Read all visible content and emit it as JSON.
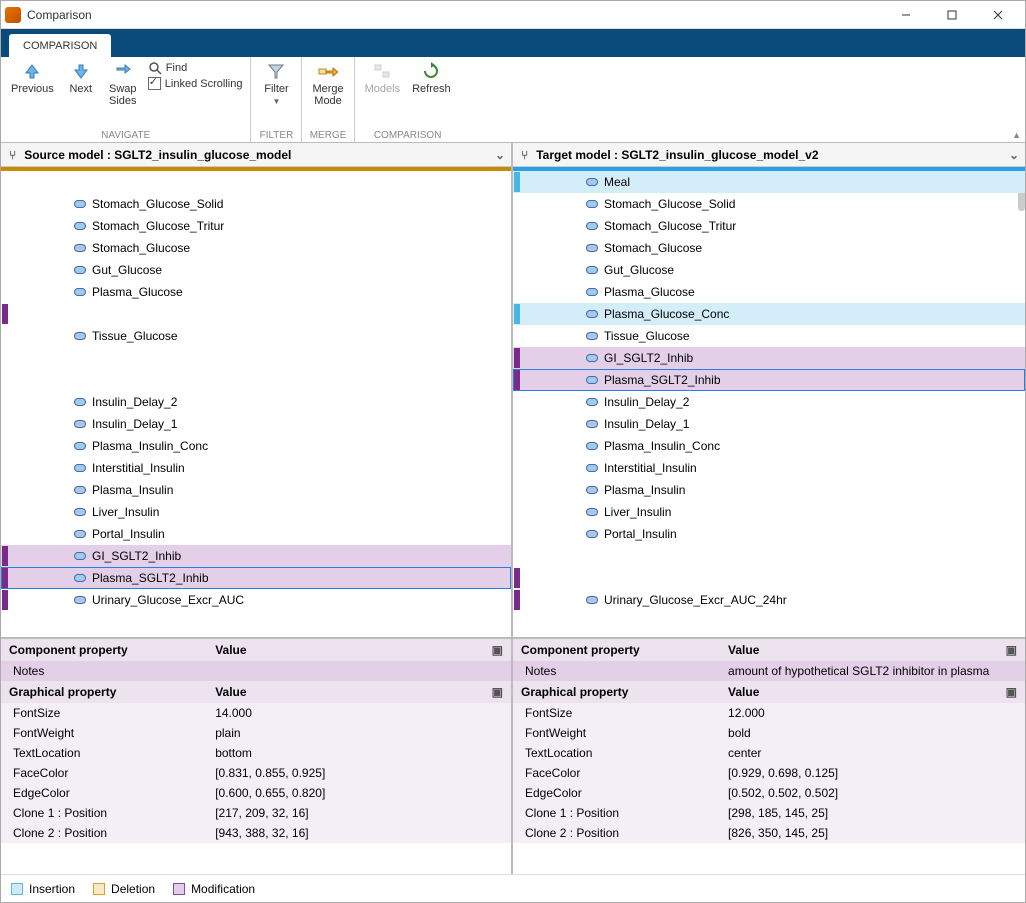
{
  "window": {
    "title": "Comparison"
  },
  "ribbon": {
    "tab": "COMPARISON"
  },
  "toolbar": {
    "previous": "Previous",
    "next": "Next",
    "swap": "Swap\nSides",
    "find": "Find",
    "linked_scrolling": "Linked Scrolling",
    "filter": "Filter",
    "merge": "Merge\nMode",
    "models": "Models",
    "refresh": "Refresh",
    "group_navigate": "NAVIGATE",
    "group_filter": "FILTER",
    "group_merge": "MERGE",
    "group_comparison": "COMPARISON"
  },
  "panes": {
    "source_label": "Source model : SGLT2_insulin_glucose_model",
    "target_label": "Target model : SGLT2_insulin_glucose_model_v2"
  },
  "source_rows": [
    {
      "label": "",
      "cls": "blank",
      "flag": ""
    },
    {
      "label": "Stomach_Glucose_Solid",
      "cls": "",
      "flag": ""
    },
    {
      "label": "Stomach_Glucose_Tritur",
      "cls": "",
      "flag": ""
    },
    {
      "label": "Stomach_Glucose",
      "cls": "",
      "flag": ""
    },
    {
      "label": "Gut_Glucose",
      "cls": "",
      "flag": ""
    },
    {
      "label": "Plasma_Glucose",
      "cls": "",
      "flag": ""
    },
    {
      "label": "",
      "cls": "blank",
      "flag": "modification"
    },
    {
      "label": "Tissue_Glucose",
      "cls": "",
      "flag": ""
    },
    {
      "label": "",
      "cls": "blank",
      "flag": ""
    },
    {
      "label": "",
      "cls": "blank",
      "flag": ""
    },
    {
      "label": "Insulin_Delay_2",
      "cls": "",
      "flag": ""
    },
    {
      "label": "Insulin_Delay_1",
      "cls": "",
      "flag": ""
    },
    {
      "label": "Plasma_Insulin_Conc",
      "cls": "",
      "flag": ""
    },
    {
      "label": "Interstitial_Insulin",
      "cls": "",
      "flag": ""
    },
    {
      "label": "Plasma_Insulin",
      "cls": "",
      "flag": ""
    },
    {
      "label": "Liver_Insulin",
      "cls": "",
      "flag": ""
    },
    {
      "label": "Portal_Insulin",
      "cls": "",
      "flag": ""
    },
    {
      "label": "GI_SGLT2_Inhib",
      "cls": "modification",
      "flag": "modification"
    },
    {
      "label": "Plasma_SGLT2_Inhib",
      "cls": "selected",
      "flag": "modification"
    },
    {
      "label": "Urinary_Glucose_Excr_AUC",
      "cls": "",
      "flag": "modification"
    }
  ],
  "target_rows": [
    {
      "label": "Meal",
      "cls": "insertion",
      "flag": "insertion"
    },
    {
      "label": "Stomach_Glucose_Solid",
      "cls": "",
      "flag": ""
    },
    {
      "label": "Stomach_Glucose_Tritur",
      "cls": "",
      "flag": ""
    },
    {
      "label": "Stomach_Glucose",
      "cls": "",
      "flag": ""
    },
    {
      "label": "Gut_Glucose",
      "cls": "",
      "flag": ""
    },
    {
      "label": "Plasma_Glucose",
      "cls": "",
      "flag": ""
    },
    {
      "label": "Plasma_Glucose_Conc",
      "cls": "insertion",
      "flag": "insertion"
    },
    {
      "label": "Tissue_Glucose",
      "cls": "",
      "flag": ""
    },
    {
      "label": "GI_SGLT2_Inhib",
      "cls": "modification",
      "flag": "modification"
    },
    {
      "label": "Plasma_SGLT2_Inhib",
      "cls": "selected",
      "flag": "modification"
    },
    {
      "label": "Insulin_Delay_2",
      "cls": "",
      "flag": ""
    },
    {
      "label": "Insulin_Delay_1",
      "cls": "",
      "flag": ""
    },
    {
      "label": "Plasma_Insulin_Conc",
      "cls": "",
      "flag": ""
    },
    {
      "label": "Interstitial_Insulin",
      "cls": "",
      "flag": ""
    },
    {
      "label": "Plasma_Insulin",
      "cls": "",
      "flag": ""
    },
    {
      "label": "Liver_Insulin",
      "cls": "",
      "flag": ""
    },
    {
      "label": "Portal_Insulin",
      "cls": "",
      "flag": ""
    },
    {
      "label": "",
      "cls": "blank",
      "flag": ""
    },
    {
      "label": "",
      "cls": "blank",
      "flag": "modification"
    },
    {
      "label": "Urinary_Glucose_Excr_AUC_24hr",
      "cls": "",
      "flag": "modification"
    }
  ],
  "props": {
    "component_header_prop": "Component property",
    "component_header_val": "Value",
    "graphical_header_prop": "Graphical property",
    "graphical_header_val": "Value",
    "notes_label": "Notes",
    "source": {
      "notes": "",
      "rows": [
        {
          "k": "FontSize",
          "v": "14.000"
        },
        {
          "k": "FontWeight",
          "v": "plain"
        },
        {
          "k": "TextLocation",
          "v": "bottom"
        },
        {
          "k": "FaceColor",
          "v": "[0.831, 0.855, 0.925]"
        },
        {
          "k": "EdgeColor",
          "v": "[0.600, 0.655, 0.820]"
        },
        {
          "k": "Clone 1 : Position",
          "v": "[217, 209, 32, 16]"
        },
        {
          "k": "Clone 2 : Position",
          "v": "[943, 388, 32, 16]"
        }
      ]
    },
    "target": {
      "notes": "amount of hypothetical SGLT2 inhibitor in plasma",
      "rows": [
        {
          "k": "FontSize",
          "v": "12.000"
        },
        {
          "k": "FontWeight",
          "v": "bold"
        },
        {
          "k": "TextLocation",
          "v": "center"
        },
        {
          "k": "FaceColor",
          "v": "[0.929, 0.698, 0.125]"
        },
        {
          "k": "EdgeColor",
          "v": "[0.502, 0.502, 0.502]"
        },
        {
          "k": "Clone 1 : Position",
          "v": "[298, 185, 145, 25]"
        },
        {
          "k": "Clone 2 : Position",
          "v": "[826, 350, 145, 25]"
        }
      ]
    }
  },
  "legend": {
    "insertion": "Insertion",
    "deletion": "Deletion",
    "modification": "Modification"
  }
}
